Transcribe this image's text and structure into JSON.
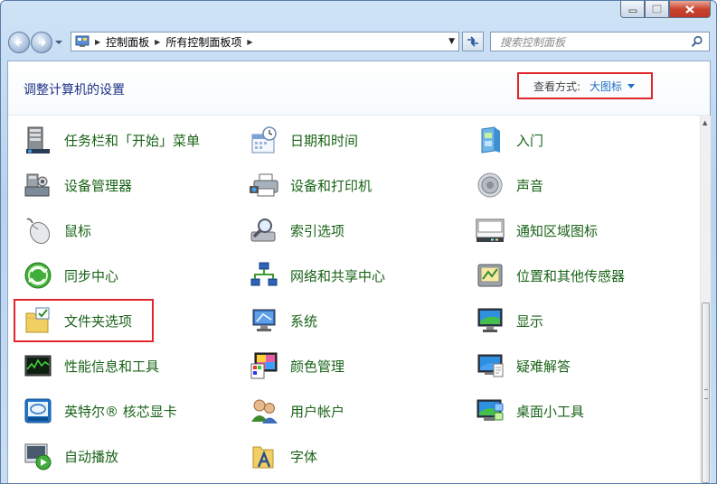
{
  "address": {
    "crumbs": [
      "控制面板",
      "所有控制面板项"
    ]
  },
  "search": {
    "placeholder": "搜索控制面板"
  },
  "header": {
    "title": "调整计算机的设置",
    "view_label": "查看方式:",
    "view_value": "大图标"
  },
  "items": [
    {
      "label": "任务栏和「开始」菜单",
      "icon": "taskbar-icon"
    },
    {
      "label": "日期和时间",
      "icon": "calendar-clock-icon"
    },
    {
      "label": "入门",
      "icon": "getting-started-icon"
    },
    {
      "label": "设备管理器",
      "icon": "device-manager-icon"
    },
    {
      "label": "设备和打印机",
      "icon": "printer-icon"
    },
    {
      "label": "声音",
      "icon": "speaker-icon"
    },
    {
      "label": "鼠标",
      "icon": "mouse-icon"
    },
    {
      "label": "索引选项",
      "icon": "magnifier-icon"
    },
    {
      "label": "通知区域图标",
      "icon": "notification-area-icon"
    },
    {
      "label": "同步中心",
      "icon": "sync-icon"
    },
    {
      "label": "网络和共享中心",
      "icon": "network-icon"
    },
    {
      "label": "位置和其他传感器",
      "icon": "location-sensor-icon"
    },
    {
      "label": "文件夹选项",
      "icon": "folder-options-icon"
    },
    {
      "label": "系统",
      "icon": "system-icon"
    },
    {
      "label": "显示",
      "icon": "display-icon"
    },
    {
      "label": "性能信息和工具",
      "icon": "performance-icon"
    },
    {
      "label": "颜色管理",
      "icon": "color-management-icon"
    },
    {
      "label": "疑难解答",
      "icon": "troubleshooting-icon"
    },
    {
      "label": "英特尔® 核芯显卡",
      "icon": "intel-graphics-icon"
    },
    {
      "label": "用户帐户",
      "icon": "users-icon"
    },
    {
      "label": "桌面小工具",
      "icon": "gadgets-icon"
    },
    {
      "label": "自动播放",
      "icon": "autoplay-icon"
    },
    {
      "label": "字体",
      "icon": "fonts-icon"
    }
  ],
  "colors": {
    "title_blue": "#1e3287",
    "item_green": "#1a6318",
    "highlight_red": "#e0262c",
    "link_blue": "#1f6fc6"
  }
}
